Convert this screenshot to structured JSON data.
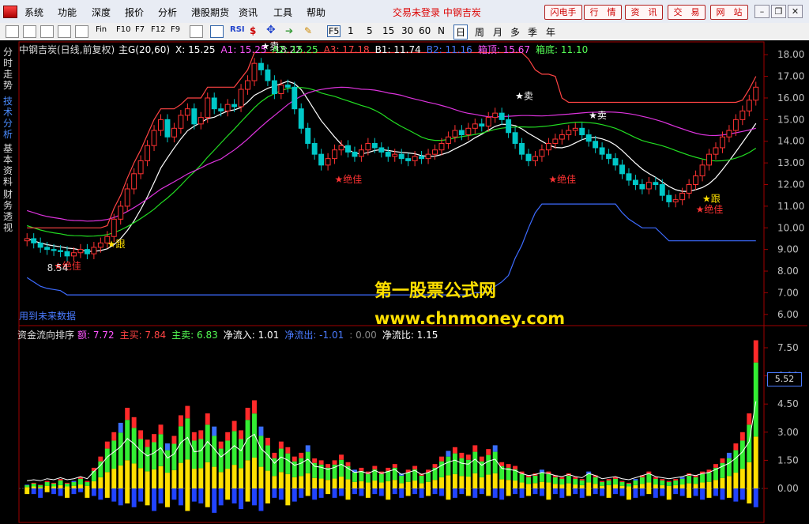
{
  "menubar": {
    "items": [
      "系统",
      "功能",
      "深度",
      "报价",
      "分析",
      "港股期货",
      "资讯",
      "工具",
      "帮助"
    ],
    "status": "交易未登录  中钢吉炭",
    "buttons": [
      "闪电手",
      "行　情",
      "资　讯",
      "交　易",
      "网　站"
    ]
  },
  "toolbar": {
    "tools": [
      "Fin",
      "F10",
      "F7",
      "F12",
      "F9",
      "RSI",
      "$"
    ],
    "periods": [
      "F5",
      "1",
      "5",
      "15",
      "30",
      "60",
      "N",
      "日",
      "周",
      "月",
      "多",
      "季",
      "年"
    ],
    "active_period": "日"
  },
  "sidebar": {
    "items": [
      "分时走势",
      "技术分析",
      "基本资料",
      "财务透视"
    ],
    "active": "技术分析"
  },
  "main_chart": {
    "title": "中钢吉炭(日线,前复权)",
    "indicators": [
      {
        "label": "主G(20,60)",
        "color": "#ffffff"
      },
      {
        "label": "X: 15.25",
        "color": "#ffffff"
      },
      {
        "label": "A1: 15.25",
        "color": "#ff55ff"
      },
      {
        "label": "A2: 15.25",
        "color": "#55ff55"
      },
      {
        "label": "A3: 17.18",
        "color": "#ff4444"
      },
      {
        "label": "B1: 11.74",
        "color": "#ffffff"
      },
      {
        "label": "B2: 11.16",
        "color": "#4a7bff"
      },
      {
        "label": "箱顶: 15.67",
        "color": "#ff55ff"
      },
      {
        "label": "箱底: 11.10",
        "color": "#55ff55"
      }
    ],
    "y_ticks": [
      "18.00",
      "17.00",
      "16.00",
      "15.00",
      "14.00",
      "13.00",
      "12.00",
      "11.00",
      "10.00",
      "9.00",
      "8.00",
      "7.00",
      "6.00"
    ],
    "annotations": {
      "sell": "卖",
      "follow": "跟",
      "best": "绝佳",
      "high_price": "18.22",
      "low_price": "8.54"
    },
    "future_data": "用到未来数据"
  },
  "watermark": {
    "title": "第一股票公式网",
    "url": "www.chnmoney.com"
  },
  "sub_chart": {
    "title": "资金流向排序",
    "indicators": [
      {
        "label": "额: 7.72",
        "color": "#ff55ff"
      },
      {
        "label": "主买: 7.84",
        "color": "#ff4444"
      },
      {
        "label": "主卖: 6.83",
        "color": "#55ff55"
      },
      {
        "label": "净流入: 1.01",
        "color": "#ffffff"
      },
      {
        "label": "净流出: -1.01",
        "color": "#4a7bff"
      },
      {
        "label": ": 0.00",
        "color": "#888888"
      },
      {
        "label": "净流比: 1.15",
        "color": "#ffffff"
      }
    ],
    "y_ticks": [
      "7.50",
      "6.00",
      "4.50",
      "3.00",
      "1.50",
      "0.00"
    ],
    "cursor_value": "5.52"
  },
  "colors": {
    "up": "#ff3232",
    "down": "#00c8c8",
    "a3_line": "#ff4444",
    "a2_line": "#22dd22",
    "a1_line": "#dd33dd",
    "b_line": "#ffffff",
    "b2_line": "#3d6bff",
    "axis": "#a00000",
    "label": "#c0c0c0"
  },
  "chart_data": {
    "type": "candlestick",
    "ylim": [
      5.7,
      18.3
    ],
    "closes": [
      9.5,
      9.3,
      9.1,
      9.0,
      8.95,
      8.9,
      8.7,
      8.85,
      9.0,
      8.8,
      9.1,
      9.3,
      9.6,
      10.4,
      11.0,
      11.8,
      12.5,
      13.1,
      13.8,
      14.5,
      15.0,
      14.2,
      14.6,
      15.2,
      15.5,
      14.8,
      15.1,
      16.0,
      15.5,
      15.4,
      15.7,
      15.6,
      16.4,
      16.8,
      17.6,
      17.3,
      16.8,
      16.2,
      16.6,
      16.5,
      15.5,
      14.6,
      13.9,
      13.4,
      12.9,
      13.2,
      13.6,
      13.8,
      13.5,
      13.3,
      13.6,
      13.9,
      13.7,
      13.5,
      13.3,
      13.4,
      13.2,
      13.1,
      13.3,
      13.2,
      13.4,
      13.6,
      13.9,
      14.2,
      14.5,
      14.3,
      14.6,
      14.8,
      14.7,
      15.1,
      15.3,
      15.0,
      14.4,
      13.9,
      13.4,
      13.1,
      13.3,
      13.6,
      13.9,
      14.1,
      14.3,
      14.5,
      14.6,
      14.3,
      14.0,
      13.7,
      13.4,
      13.2,
      12.9,
      12.5,
      12.2,
      12.0,
      11.8,
      12.1,
      12.0,
      11.5,
      11.2,
      11.3,
      11.6,
      12.0,
      12.4,
      12.9,
      13.4,
      13.7,
      14.2,
      14.5,
      15.0,
      15.4,
      15.9,
      16.5
    ],
    "money_flow_buy": [
      0.2,
      0.3,
      0.2,
      0.4,
      0.3,
      0.5,
      0.3,
      0.4,
      0.6,
      0.4,
      1.1,
      1.7,
      2.5,
      3.0,
      3.5,
      4.3,
      3.8,
      3.1,
      2.6,
      2.9,
      3.4,
      2.4,
      2.8,
      3.9,
      4.4,
      3.0,
      3.1,
      4.0,
      3.3,
      2.5,
      3.0,
      3.6,
      3.1,
      4.3,
      4.7,
      3.3,
      2.7,
      1.9,
      2.5,
      2.2,
      1.7,
      1.9,
      2.3,
      1.6,
      1.5,
      1.3,
      1.5,
      1.8,
      1.4,
      1.0,
      1.1,
      0.9,
      1.2,
      0.9,
      1.1,
      1.3,
      0.8,
      1.0,
      1.2,
      0.8,
      1.0,
      1.3,
      1.7,
      2.0,
      2.2,
      1.9,
      1.8,
      2.3,
      1.7,
      2.1,
      2.3,
      1.4,
      1.3,
      1.2,
      0.9,
      0.7,
      0.8,
      1.0,
      0.9,
      0.7,
      0.6,
      0.8,
      0.6,
      0.5,
      0.9,
      0.7,
      0.4,
      0.5,
      0.6,
      0.4,
      0.3,
      0.5,
      0.7,
      0.9,
      0.6,
      0.5,
      0.4,
      0.5,
      0.6,
      0.8,
      0.7,
      0.9,
      1.0,
      1.3,
      1.6,
      1.9,
      2.4,
      3.0,
      4.0,
      7.9
    ],
    "money_flow_sell": [
      0.3,
      0.3,
      0.5,
      0.2,
      0.3,
      0.4,
      0.5,
      0.3,
      0.2,
      0.5,
      0.4,
      0.6,
      0.5,
      0.7,
      0.9,
      0.8,
      1.0,
      0.7,
      0.9,
      1.2,
      0.8,
      1.0,
      0.6,
      0.9,
      1.2,
      0.7,
      0.8,
      1.0,
      1.3,
      0.9,
      0.6,
      0.8,
      1.1,
      0.7,
      0.9,
      1.2,
      0.8,
      0.5,
      0.6,
      0.9,
      0.7,
      0.5,
      0.4,
      0.6,
      0.5,
      0.3,
      0.5,
      0.4,
      0.6,
      0.3,
      0.4,
      0.5,
      0.3,
      0.4,
      0.6,
      0.3,
      0.5,
      0.4,
      0.3,
      0.5,
      0.4,
      0.3,
      0.4,
      0.6,
      0.5,
      0.3,
      0.4,
      0.5,
      0.3,
      0.4,
      0.5,
      0.6,
      0.4,
      0.3,
      0.5,
      0.4,
      0.3,
      0.4,
      0.6,
      0.3,
      0.5,
      0.4,
      0.3,
      0.5,
      0.4,
      0.3,
      0.4,
      0.5,
      0.3,
      0.4,
      0.6,
      0.5,
      0.4,
      0.3,
      0.5,
      0.4,
      0.6,
      0.3,
      0.4,
      0.5,
      0.4,
      0.6,
      0.5,
      0.4,
      0.6,
      0.5,
      0.7,
      0.6,
      0.8,
      1.0
    ]
  }
}
